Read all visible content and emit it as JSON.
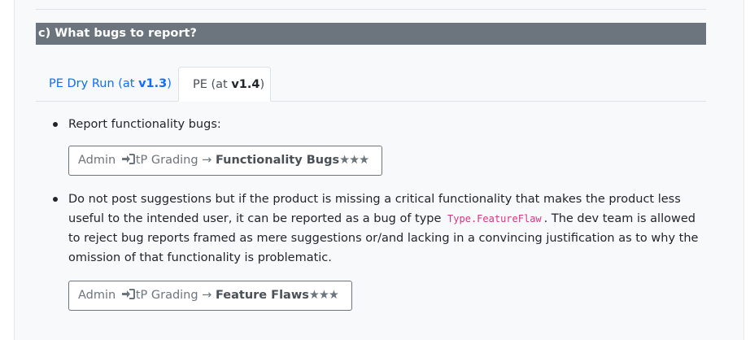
{
  "section": {
    "title": "c) What bugs to report?"
  },
  "tabs": [
    {
      "prefix": "PE Dry Run (at ",
      "version": "v1.3",
      "suffix": ")"
    },
    {
      "prefix": "PE (at ",
      "version": "v1.4",
      "suffix": ")"
    }
  ],
  "bullets": [
    {
      "text": "Report functionality bugs:"
    },
    {
      "text_before": "Do not post suggestions but if the product is missing a critical functionality that makes the product less useful to the intended user, it can be reported as a bug of type ",
      "code": "Type.FeatureFlaw",
      "text_after": ". The dev team is allowed to reject bug reports framed as mere suggestions or/and lacking in a convincing justification as to why the omission of that functionality is problematic."
    }
  ],
  "breadcrumbs": [
    {
      "root": "Admin",
      "icon": "login-icon",
      "middle": "tP Grading →",
      "last": "Functionality Bugs",
      "stars": "★★★"
    },
    {
      "root": "Admin",
      "icon": "login-icon",
      "middle": "tP Grading →",
      "last": "Feature Flaws",
      "stars": "★★★"
    }
  ],
  "colors": {
    "header_bg": "#6c757d",
    "link": "#0d6efd",
    "code": "#d63384"
  }
}
